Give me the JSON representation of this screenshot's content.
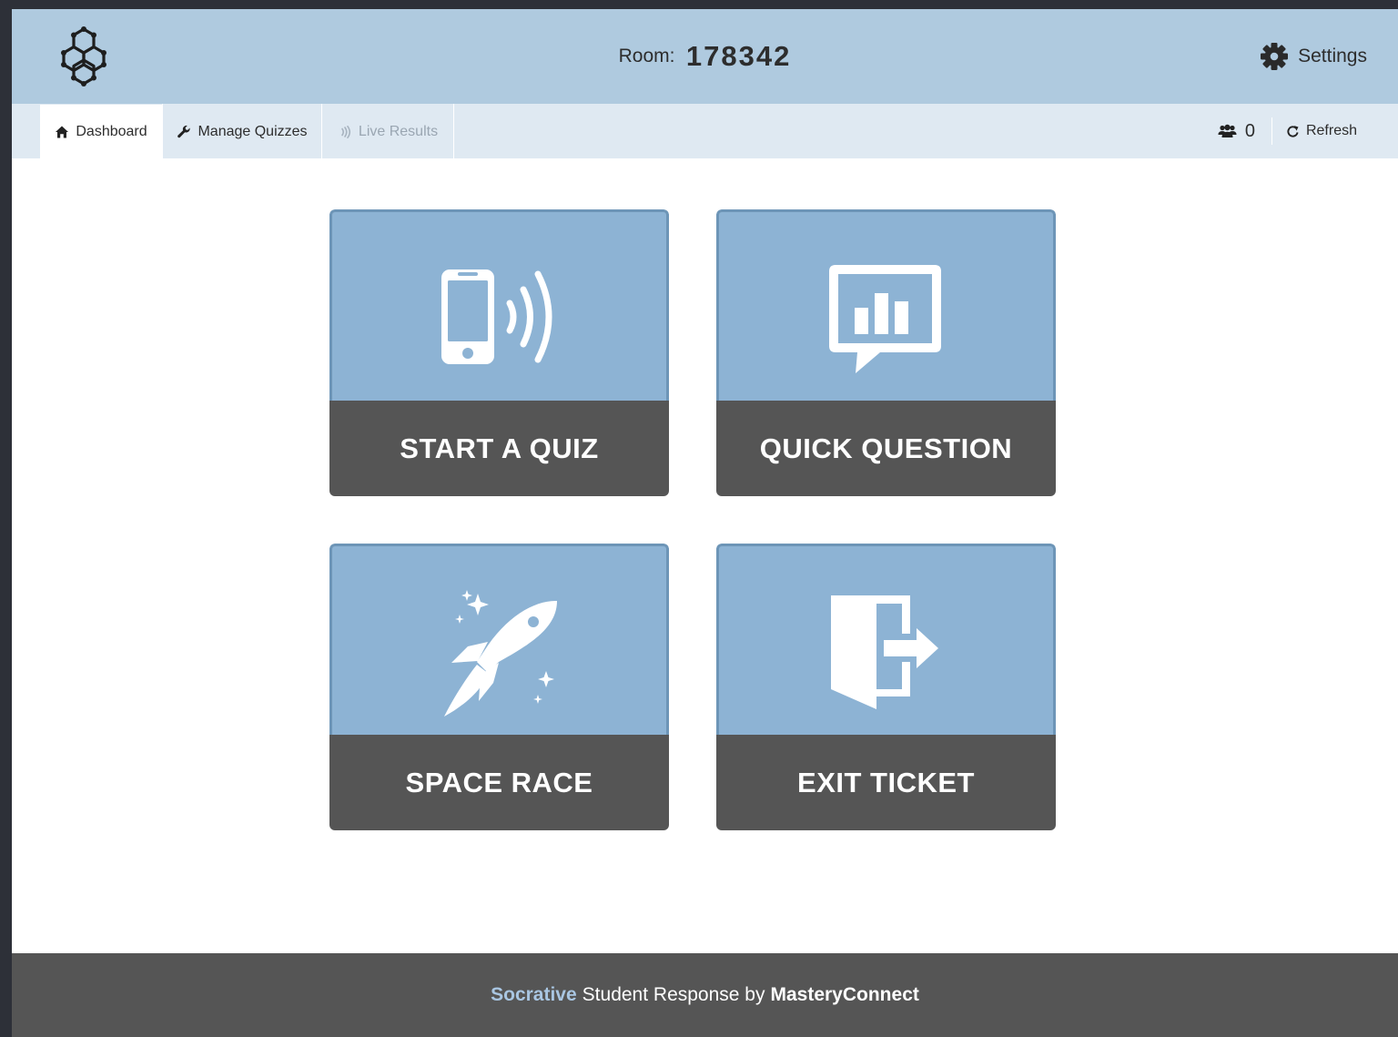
{
  "header": {
    "room_label": "Room:",
    "room_code": "178342",
    "settings_label": "Settings",
    "logo_icon": "hexagon-molecule-logo"
  },
  "nav": {
    "tabs": [
      {
        "label": "Dashboard",
        "icon": "home-icon",
        "active": true,
        "disabled": false
      },
      {
        "label": "Manage Quizzes",
        "icon": "wrench-icon",
        "active": false,
        "disabled": false
      },
      {
        "label": "Live Results",
        "icon": "signal-waves-icon",
        "active": false,
        "disabled": true
      }
    ],
    "student_count": "0",
    "refresh_label": "Refresh"
  },
  "tiles": [
    {
      "label": "START A QUIZ",
      "icon": "phone-broadcast-icon"
    },
    {
      "label": "QUICK QUESTION",
      "icon": "chart-speech-bubble-icon"
    },
    {
      "label": "SPACE RACE",
      "icon": "rocket-icon"
    },
    {
      "label": "EXIT TICKET",
      "icon": "door-exit-icon"
    }
  ],
  "footer": {
    "brand": "Socrative",
    "middle": "Student Response by",
    "company": "MasteryConnect"
  },
  "colors": {
    "header_bg": "#afcadf",
    "nav_bg": "#dfe9f2",
    "tile_top": "#8db3d4",
    "tile_bottom": "#555555",
    "footer_bg": "#555555",
    "brand_accent": "#a9c6e2"
  }
}
